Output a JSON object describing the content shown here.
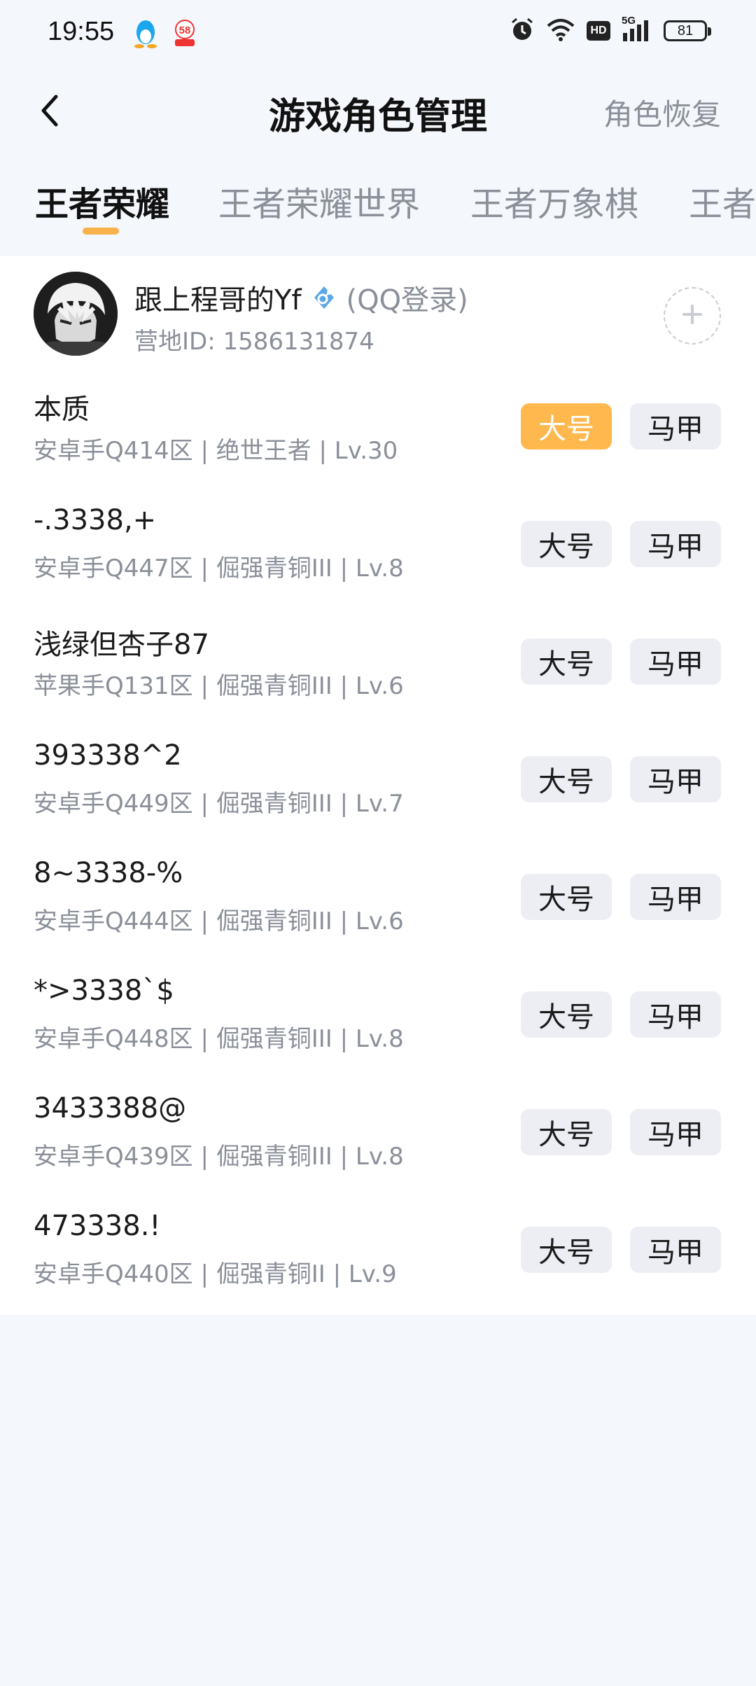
{
  "status_bar": {
    "time": "19:55",
    "network": "5G",
    "hd": "HD",
    "battery": "81"
  },
  "header": {
    "title": "游戏角色管理",
    "restore_label": "角色恢复"
  },
  "tabs": [
    {
      "label": "王者荣耀",
      "active": true
    },
    {
      "label": "王者荣耀世界",
      "active": false
    },
    {
      "label": "王者万象棋",
      "active": false
    },
    {
      "label": "王者",
      "active": false
    }
  ],
  "profile": {
    "name": "跟上程哥的Yf",
    "login_type": "(QQ登录)",
    "camp_id_label": "营地ID:",
    "camp_id": "1586131874"
  },
  "buttons": {
    "main_label": "大号",
    "alt_label": "马甲"
  },
  "roles": [
    {
      "name": "本质",
      "info": "安卓手Q414区 | 绝世王者 | Lv.30",
      "selected": "main"
    },
    {
      "name": "-.3338,+",
      "info": "安卓手Q447区 | 倔强青铜III | Lv.8",
      "selected": "none"
    },
    {
      "name": "浅绿但杏子87",
      "info": "苹果手Q131区 | 倔强青铜III | Lv.6",
      "selected": "none"
    },
    {
      "name": "393338^2",
      "info": "安卓手Q449区 | 倔强青铜III | Lv.7",
      "selected": "none"
    },
    {
      "name": "8~3338-%",
      "info": "安卓手Q444区 | 倔强青铜III | Lv.6",
      "selected": "none"
    },
    {
      "name": "*>3338`$",
      "info": "安卓手Q448区 | 倔强青铜III | Lv.8",
      "selected": "none"
    },
    {
      "name": "3433388@",
      "info": "安卓手Q439区 | 倔强青铜III | Lv.8",
      "selected": "none"
    },
    {
      "name": "473338.!",
      "info": "安卓手Q440区 | 倔强青铜II | Lv.9",
      "selected": "none"
    }
  ],
  "colors": {
    "accent": "#ffb84d",
    "tab_indicator": "#f7b34a",
    "muted_text": "#8a8f99",
    "button_bg": "#eceef3"
  }
}
